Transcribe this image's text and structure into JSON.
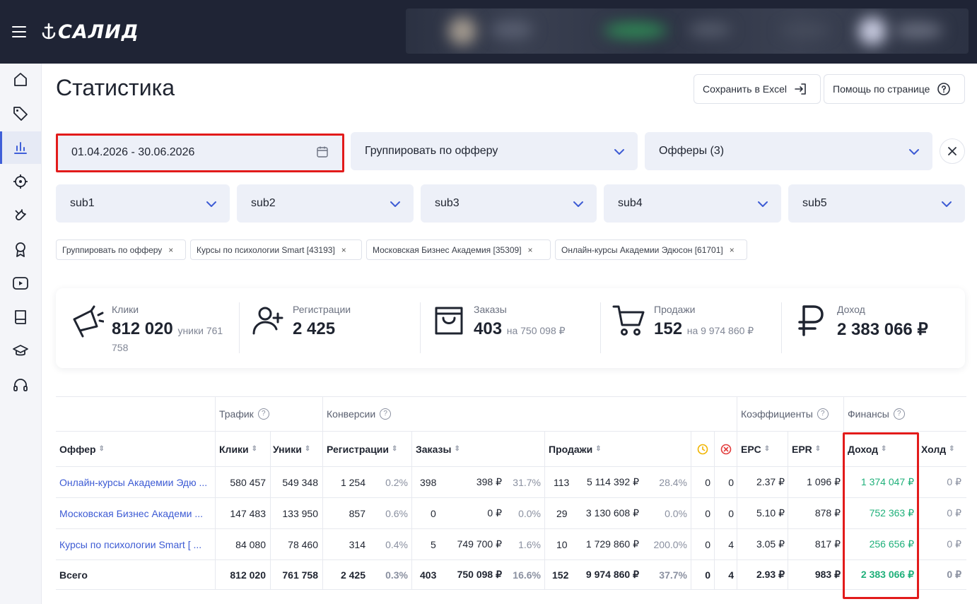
{
  "app": {
    "logo_text": "САЛИД"
  },
  "page": {
    "title": "Статистика"
  },
  "header_buttons": {
    "excel": "Сохранить в Excel",
    "help": "Помощь по странице"
  },
  "filters": {
    "date_range": "01.04.2026 - 30.06.2026",
    "group_by": "Группировать по офферу",
    "offers": "Офферы (3)",
    "subs": [
      "sub1",
      "sub2",
      "sub3",
      "sub4",
      "sub5"
    ]
  },
  "chips": [
    "Группировать по офферу",
    "Курсы по психологии Smart [43193]",
    "Московская Бизнес Академия [35309]",
    "Онлайн-курсы Академии Эдюсон [61701]"
  ],
  "summary": {
    "clicks": {
      "label": "Клики",
      "value": "812 020",
      "sub_a": "уники 761",
      "sub_b": "758"
    },
    "registrations": {
      "label": "Регистрации",
      "value": "2 425"
    },
    "orders": {
      "label": "Заказы",
      "value": "403",
      "sub": "на 750 098 ₽"
    },
    "sales": {
      "label": "Продажи",
      "value": "152",
      "sub": "на 9 974 860 ₽"
    },
    "income": {
      "label": "Доход",
      "value": "2 383 066 ₽"
    }
  },
  "table": {
    "groups": {
      "traffic": "Трафик",
      "conversions": "Конверсии",
      "coefficients": "Коэффициенты",
      "finance": "Финансы"
    },
    "columns": {
      "offer": "Оффер",
      "clicks": "Клики",
      "uniques": "Уники",
      "registrations": "Регистрации",
      "orders": "Заказы",
      "sales": "Продажи",
      "epc": "EPC",
      "epr": "EPR",
      "income": "Доход",
      "hold": "Холд"
    },
    "rows": [
      {
        "offer": "Онлайн-курсы Академии Эдю",
        "clicks": "580 457",
        "uniques": "549 348",
        "reg": "1 254",
        "reg_pct": "0.2%",
        "orders": "398",
        "orders_sum": "398 ₽",
        "orders_pct": "31.7%",
        "sales": "113",
        "sales_sum": "5 114 392 ₽",
        "sales_pct": "28.4%",
        "pending": "0",
        "rejected": "0",
        "epc": "2.37 ₽",
        "epr": "1 096 ₽",
        "income": "1 374 047 ₽",
        "hold": "0 ₽"
      },
      {
        "offer": "Московская Бизнес Академи",
        "clicks": "147 483",
        "uniques": "133 950",
        "reg": "857",
        "reg_pct": "0.6%",
        "orders": "0",
        "orders_sum": "0 ₽",
        "orders_pct": "0.0%",
        "sales": "29",
        "sales_sum": "3 130 608 ₽",
        "sales_pct": "0.0%",
        "pending": "0",
        "rejected": "0",
        "epc": "5.10 ₽",
        "epr": "878 ₽",
        "income": "752 363 ₽",
        "hold": "0 ₽"
      },
      {
        "offer": "Курсы по психологии Smart [",
        "clicks": "84 080",
        "uniques": "78 460",
        "reg": "314",
        "reg_pct": "0.4%",
        "orders": "5",
        "orders_sum": "749 700 ₽",
        "orders_pct": "1.6%",
        "sales": "10",
        "sales_sum": "1 729 860 ₽",
        "sales_pct": "200.0%",
        "pending": "0",
        "rejected": "4",
        "epc": "3.05 ₽",
        "epr": "817 ₽",
        "income": "256 656 ₽",
        "hold": "0 ₽"
      }
    ],
    "total": {
      "offer": "Всего",
      "clicks": "812 020",
      "uniques": "761 758",
      "reg": "2 425",
      "reg_pct": "0.3%",
      "orders": "403",
      "orders_sum": "750 098 ₽",
      "orders_pct": "16.6%",
      "sales": "152",
      "sales_sum": "9 974 860 ₽",
      "sales_pct": "37.7%",
      "pending": "0",
      "rejected": "4",
      "epc": "2.93 ₽",
      "epr": "983 ₽",
      "income": "2 383 066 ₽",
      "hold": "0 ₽"
    }
  },
  "colors": {
    "topbar": "#1f2435",
    "accent": "#3d5bd4",
    "income_green": "#1fb07a",
    "highlight_red": "#e21b1b",
    "pending_yellow": "#f0b400",
    "rejected_red": "#e23b3b"
  },
  "icons": [
    "menu-icon",
    "home-icon",
    "tag-icon",
    "chart-icon",
    "target-icon",
    "tools-icon",
    "award-icon",
    "video-icon",
    "book-icon",
    "graduation-icon",
    "headset-icon"
  ]
}
